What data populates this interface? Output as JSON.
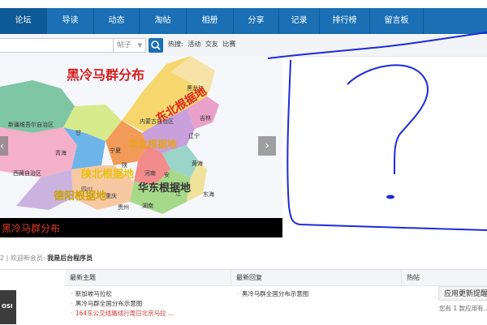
{
  "nav": {
    "items": [
      {
        "label": "论坛",
        "active": true
      },
      {
        "label": "导读"
      },
      {
        "label": "动态"
      },
      {
        "label": "淘帖"
      },
      {
        "label": "相册"
      },
      {
        "label": "分享"
      },
      {
        "label": "记录"
      },
      {
        "label": "排行榜"
      },
      {
        "label": "留言板"
      }
    ],
    "color": "#1a6fb5"
  },
  "search": {
    "type_label": "帖子",
    "hot_label": "热搜:",
    "hot_terms": [
      "活动",
      "交友",
      "比赛"
    ]
  },
  "map": {
    "title": "黑冷马群分布",
    "regions": [
      "新疆维吾尔自治区",
      "西藏自治区",
      "青海",
      "甘",
      "内蒙古自治区",
      "黑龙江",
      "吉林",
      "辽宁",
      "宁夏",
      "陕",
      "河南",
      "安",
      "黄海",
      "东海",
      "重庆",
      "四川",
      "湖南",
      "贵州",
      "江"
    ],
    "bases": [
      "东北根据地",
      "华北根据地",
      "陕北根据地",
      "华东根据地",
      "德阳根据地"
    ],
    "caption": "黑冷马群分布"
  },
  "members": {
    "count": "2",
    "welcome": "欢迎新会员:",
    "name": "我是后台程序员"
  },
  "panels": {
    "latest_topics": {
      "title": "最新主题",
      "items": [
        "新加坡马拉松",
        "黑冷马群全国分布示意图",
        "164东公交线路线行周日北京马拉 ..."
      ]
    },
    "latest_replies": {
      "title": "最新回复",
      "items": [
        "黑冷马群全国分布示意图"
      ]
    },
    "hot": {
      "title": "热帖"
    }
  },
  "update_button": "应用更新提醒",
  "update_sub": "您有 1 款应用有..."
}
